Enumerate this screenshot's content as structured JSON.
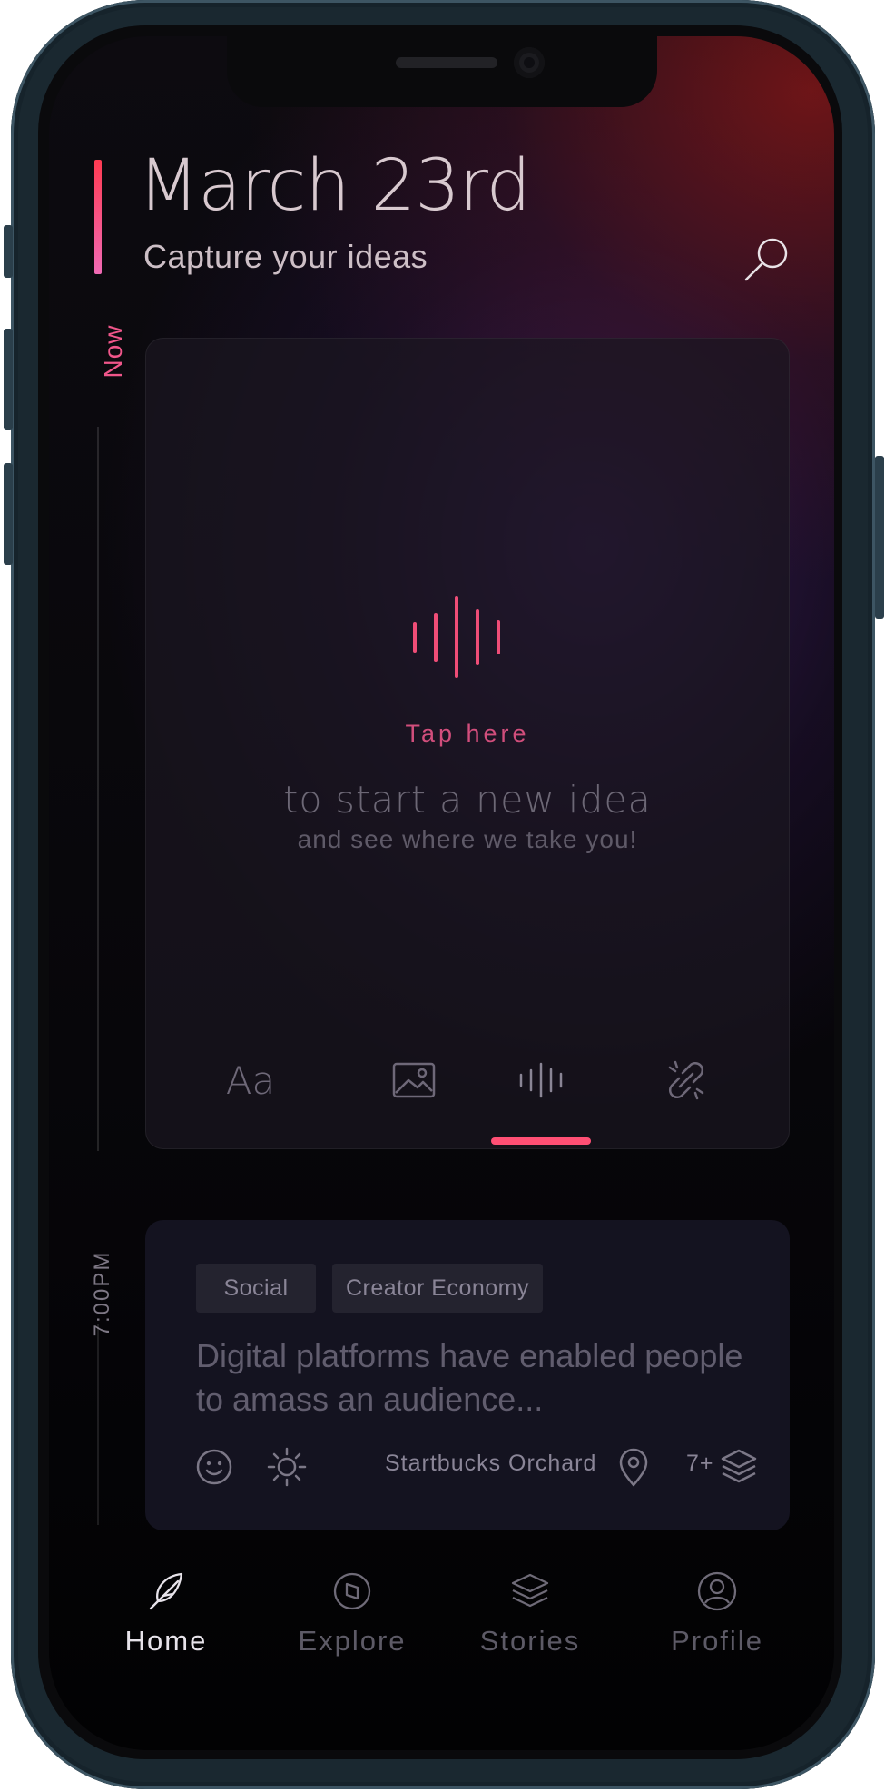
{
  "header": {
    "date": "March 23rd",
    "subtitle": "Capture your ideas"
  },
  "timeline": {
    "now_label": "Now",
    "entry_time": "7:00PM"
  },
  "capture_card": {
    "tap_label": "Tap here",
    "prompt_line_1": "to start a new idea",
    "prompt_line_2": "and see where we take you!",
    "tools": [
      {
        "id": "text",
        "label": "Aa",
        "icon": "text-icon"
      },
      {
        "id": "image",
        "icon": "image-icon"
      },
      {
        "id": "audio",
        "icon": "audio-wave-icon",
        "active": true
      },
      {
        "id": "link",
        "icon": "broken-link-icon"
      }
    ]
  },
  "idea_card": {
    "tags": [
      "Social",
      "Creator Economy"
    ],
    "text": "Digital platforms have enabled people to amass an audience...",
    "mood_icon": "smiley-icon",
    "weather_icon": "sun-icon",
    "location": "Startbucks Orchard",
    "location_icon": "map-pin-icon",
    "count": "7+",
    "layers_icon": "layers-icon"
  },
  "nav": {
    "items": [
      {
        "label": "Home",
        "icon": "feather-icon",
        "active": true
      },
      {
        "label": "Explore",
        "icon": "compass-icon"
      },
      {
        "label": "Stories",
        "icon": "layers-icon"
      },
      {
        "label": "Profile",
        "icon": "user-icon"
      }
    ]
  },
  "colors": {
    "accent": "#ff4f74",
    "accent_text": "#d24e7c",
    "background": "#07060a",
    "card": "#141320"
  }
}
